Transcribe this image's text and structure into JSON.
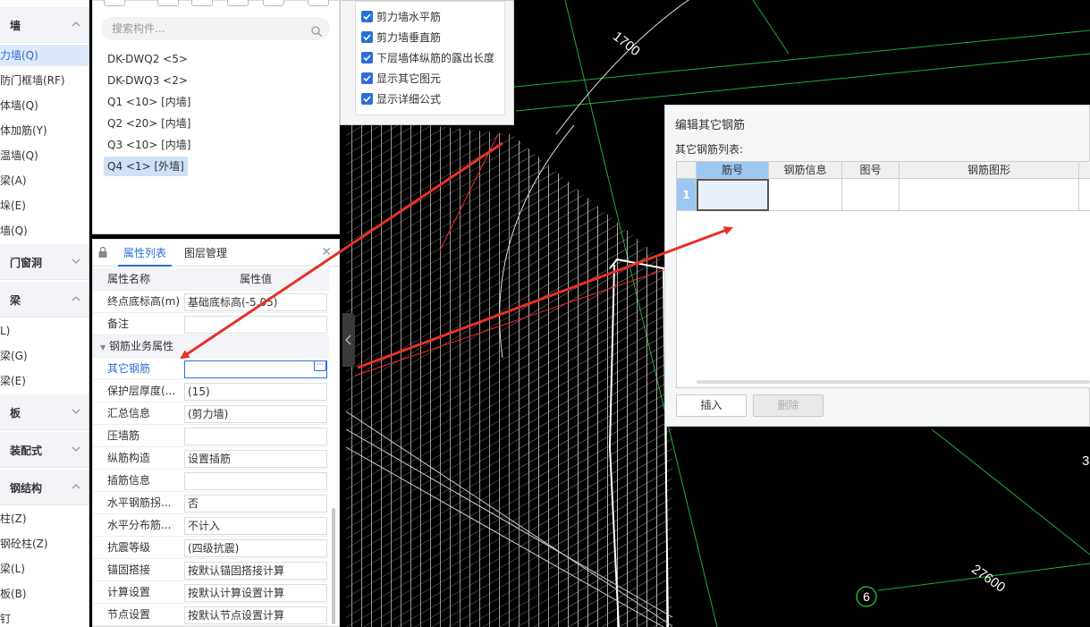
{
  "left_nav": {
    "categories": [
      {
        "label": "墙",
        "expanded": true
      },
      {
        "label": "门窗洞",
        "expanded": false
      },
      {
        "label": "梁",
        "expanded": true
      },
      {
        "label": "板",
        "expanded": false
      },
      {
        "label": "装配式",
        "expanded": false
      },
      {
        "label": "钢结构",
        "expanded": true
      }
    ],
    "wall_items": [
      "力墙(Q)",
      "防门框墙(RF)",
      "体墙(Q)",
      "体加筋(Y)",
      "温墙(Q)",
      "梁(A)",
      "垛(E)",
      "墙(Q)"
    ],
    "beam_items": [
      "L)",
      "梁(G)",
      "梁(E)"
    ],
    "steel_items": [
      "柱(Z)",
      "钢砼柱(Z)",
      "梁(L)",
      "板(B)",
      "钉"
    ]
  },
  "components": {
    "search_placeholder": "搜索构件...",
    "items": [
      "DK-DWQ2 <5>",
      "DK-DWQ3 <2>",
      "Q1 <10> [内墙]",
      "Q2 <20> [内墙]",
      "Q3 <10> [内墙]",
      "Q4 <1> [外墙]"
    ]
  },
  "properties": {
    "tabs": [
      "属性列表",
      "图层管理"
    ],
    "header": {
      "name": "属性名称",
      "value": "属性值"
    },
    "rows": [
      {
        "name": "终点底标高(m)",
        "value": "基础底标高(-5.05)"
      },
      {
        "name": "备注",
        "value": ""
      }
    ],
    "group": "钢筋业务属性",
    "rebar_rows": [
      {
        "name": "其它钢筋",
        "value": ""
      },
      {
        "name": "保护层厚度(...",
        "value": "(15)"
      },
      {
        "name": "汇总信息",
        "value": "(剪力墙)"
      },
      {
        "name": "压墙筋",
        "value": ""
      },
      {
        "name": "纵筋构造",
        "value": "设置插筋"
      },
      {
        "name": "插筋信息",
        "value": ""
      },
      {
        "name": "水平钢筋拐...",
        "value": "否"
      },
      {
        "name": "水平分布筋...",
        "value": "不计入"
      },
      {
        "name": "抗震等级",
        "value": "(四级抗震)"
      },
      {
        "name": "锚固搭接",
        "value": "按默认锚固搭接计算"
      },
      {
        "name": "计算设置",
        "value": "按默认计算设置计算"
      },
      {
        "name": "节点设置",
        "value": "按默认节点设置计算"
      }
    ]
  },
  "options": {
    "items": [
      "剪力墙水平筋",
      "剪力墙垂直筋",
      "下层墙体纵筋的露出长度",
      "显示其它图元",
      "显示详细公式"
    ]
  },
  "canvas": {
    "dims": [
      "1700",
      "27600",
      "3"
    ],
    "axis_label": "6"
  },
  "dialog": {
    "title": "编辑其它钢筋",
    "subtitle": "其它钢筋列表:",
    "columns": [
      "筋号",
      "钢筋信息",
      "图号",
      "钢筋图形"
    ],
    "row_number": "1",
    "insert_label": "插入",
    "delete_label": "删除"
  },
  "colors": {
    "accent": "#2b6fd6",
    "arrow": "#e8302a",
    "grid_green": "#1fae3b"
  }
}
